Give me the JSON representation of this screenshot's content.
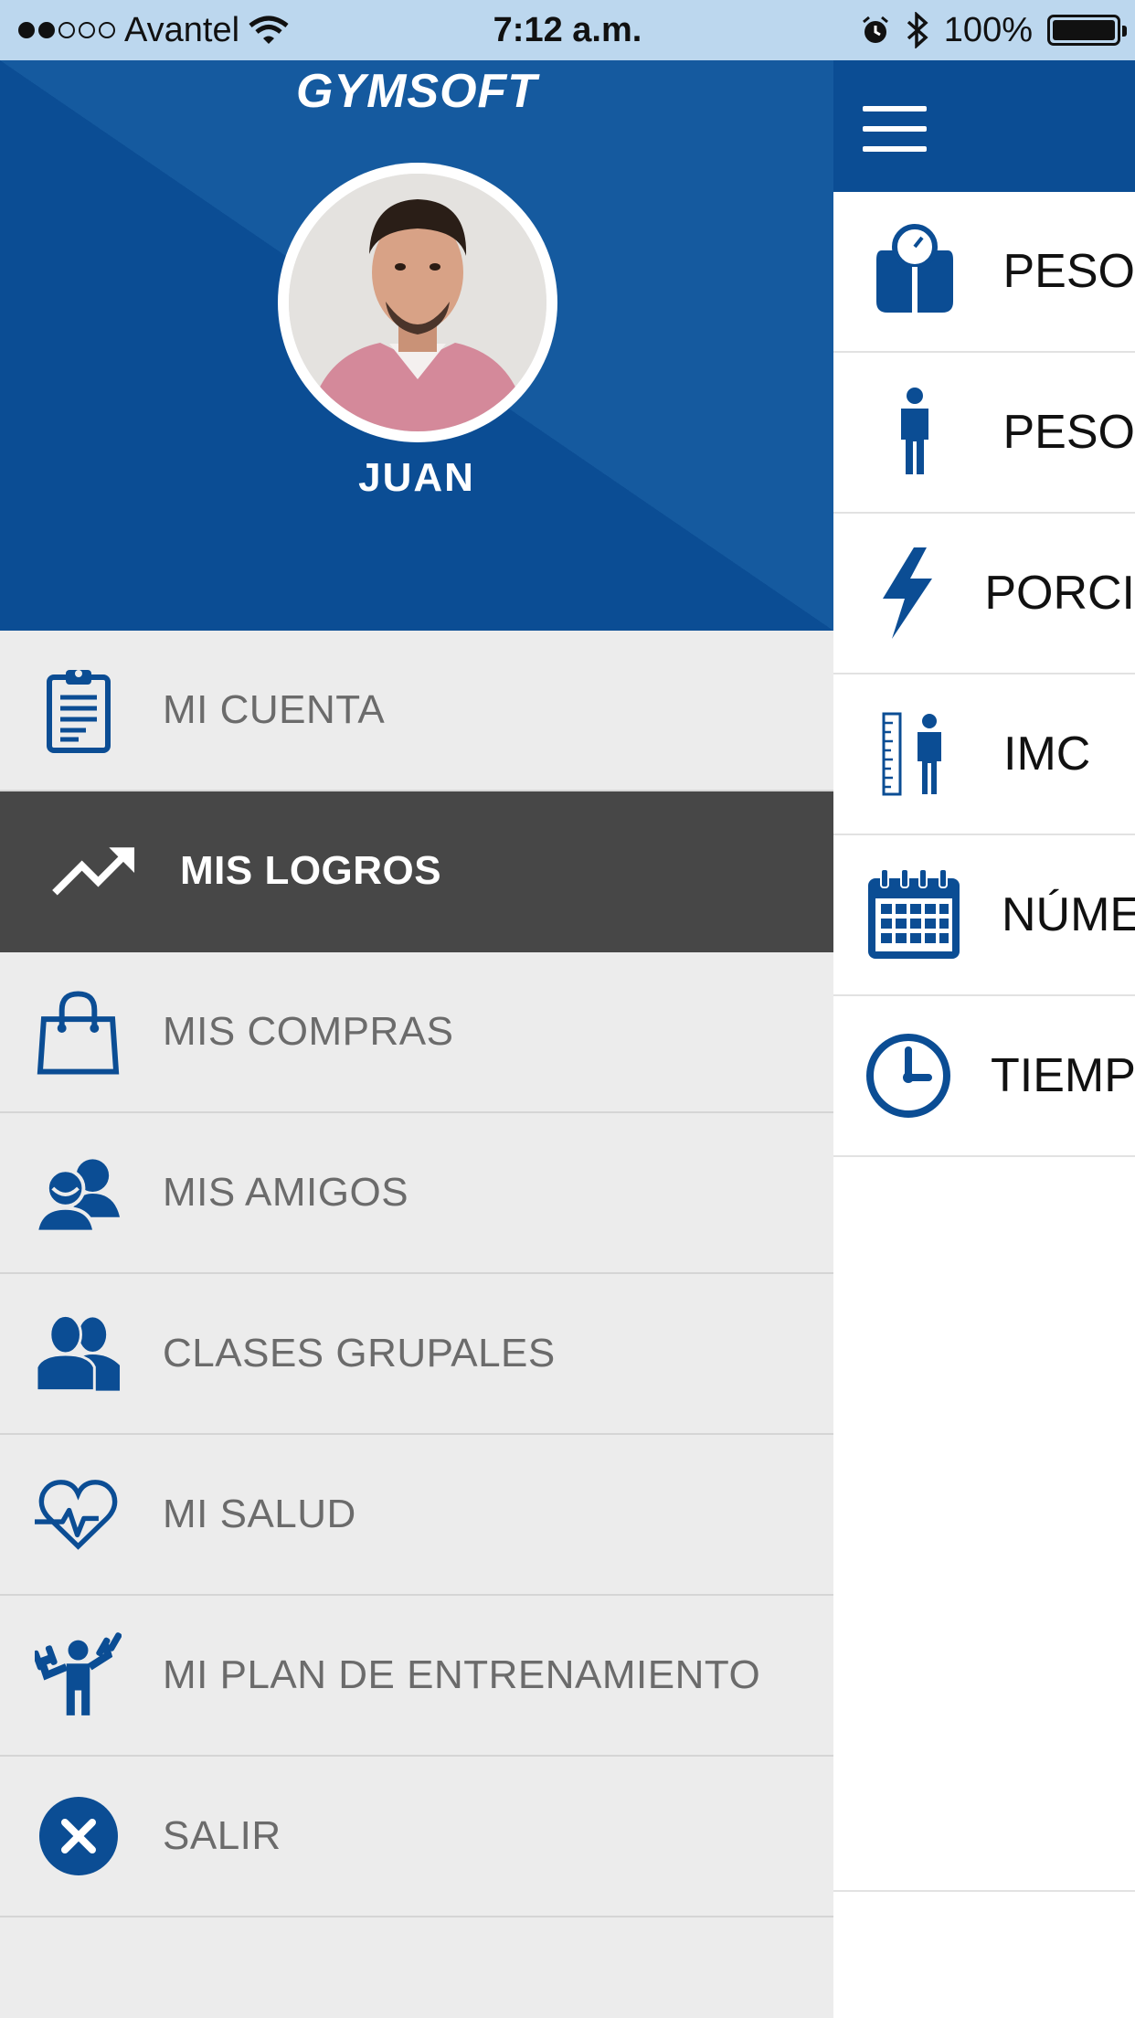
{
  "status_bar": {
    "carrier": "Avantel",
    "time": "7:12 a.m.",
    "battery": "100%",
    "signal_bars_filled": 2,
    "signal_bars_total": 5
  },
  "brand": {
    "name": "GYMSOFT"
  },
  "user": {
    "name": "JUAN"
  },
  "menu": {
    "items": [
      {
        "label": "MI CUENTA",
        "icon": "clipboard-icon"
      },
      {
        "label": "MIS LOGROS",
        "icon": "trend-up-icon",
        "active": true
      },
      {
        "label": "MIS COMPRAS",
        "icon": "shopping-bag-icon"
      },
      {
        "label": "MIS AMIGOS",
        "icon": "friends-icon"
      },
      {
        "label": "CLASES GRUPALES",
        "icon": "group-icon"
      },
      {
        "label": "MI SALUD",
        "icon": "heart-pulse-icon"
      },
      {
        "label": "MI PLAN DE ENTRENAMIENTO",
        "icon": "dumbbell-person-icon"
      },
      {
        "label": "SALIR",
        "icon": "close-circle-icon"
      }
    ]
  },
  "main": {
    "stats": [
      {
        "label": "PESO",
        "icon": "scale-icon"
      },
      {
        "label": "PESO",
        "icon": "person-icon"
      },
      {
        "label": "PORCI",
        "icon": "lightning-icon"
      },
      {
        "label": "IMC",
        "icon": "ruler-person-icon"
      },
      {
        "label": "NÚME",
        "icon": "calendar-icon"
      },
      {
        "label": "TIEMP",
        "icon": "clock-icon"
      }
    ]
  },
  "colors": {
    "brand_blue": "#0b4d94",
    "active_row": "#474747",
    "menu_bg": "#ececec",
    "status_bar": "#bcd7ee"
  }
}
